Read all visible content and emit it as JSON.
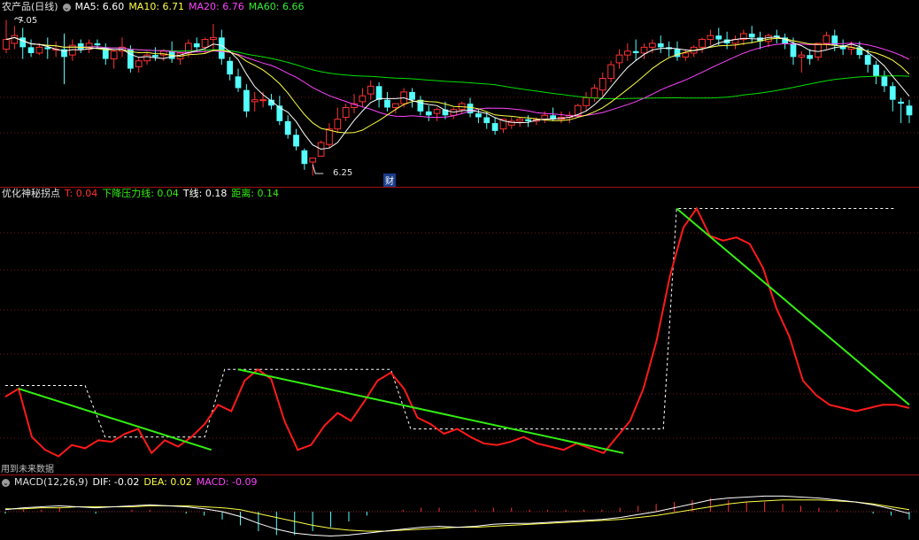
{
  "header1": {
    "name": "农产品(日线)",
    "ma5": "MA5: 6.60",
    "ma10": "MA10: 6.71",
    "ma20": "MA20: 6.76",
    "ma60": "MA60: 6.66"
  },
  "header2": {
    "name": "优化神秘拐点",
    "t": "T: 0.04",
    "down": "下降压力线: 0.04",
    "tline": "T线: 0.18",
    "dist": "距离: 0.14"
  },
  "header3": {
    "name": "MACD(12,26,9)",
    "dif": "DIF: -0.02",
    "dea": "DEA: 0.02",
    "macd": "MACD: -0.09"
  },
  "labels": {
    "high": "7.05",
    "low": "6.25",
    "cai": "财",
    "future": "用到未来数据"
  },
  "colors": {
    "up": "#ff3232",
    "down": "#54ffff",
    "ma5": "#ffffff",
    "ma10": "#ffff44",
    "ma20": "#ff44ff",
    "ma60": "#00e000",
    "t_line": "#ff1a1a",
    "pressure": "#33ee11",
    "step": "#ffffff",
    "dif": "#ffffff",
    "dea": "#ffff44"
  },
  "chart_data": [
    {
      "type": "candlestick",
      "title": "农产品(日线)",
      "candles": [
        [
          6.9,
          7.05,
          6.95,
          6.88
        ],
        [
          6.93,
          7.02,
          6.97,
          6.9
        ],
        [
          6.96,
          7.01,
          6.91,
          6.85
        ],
        [
          6.91,
          6.95,
          6.88,
          6.86
        ],
        [
          6.88,
          6.93,
          6.91,
          6.87
        ],
        [
          6.91,
          6.96,
          6.9,
          6.85
        ],
        [
          6.9,
          6.94,
          6.9,
          6.86
        ],
        [
          6.9,
          6.98,
          6.86,
          6.72
        ],
        [
          6.87,
          6.95,
          6.92,
          6.84
        ],
        [
          6.93,
          6.95,
          6.9,
          6.88
        ],
        [
          6.9,
          6.95,
          6.93,
          6.88
        ],
        [
          6.93,
          6.95,
          6.92,
          6.9
        ],
        [
          6.91,
          6.93,
          6.85,
          6.82
        ],
        [
          6.85,
          6.9,
          6.89,
          6.8
        ],
        [
          6.89,
          6.96,
          6.91,
          6.86
        ],
        [
          6.9,
          6.92,
          6.8,
          6.78
        ],
        [
          6.81,
          6.86,
          6.84,
          6.78
        ],
        [
          6.84,
          6.88,
          6.87,
          6.82
        ],
        [
          6.87,
          6.91,
          6.86,
          6.84
        ],
        [
          6.87,
          6.9,
          6.89,
          6.84
        ],
        [
          6.89,
          6.94,
          6.85,
          6.83
        ],
        [
          6.85,
          6.89,
          6.88,
          6.82
        ],
        [
          6.88,
          6.95,
          6.93,
          6.86
        ],
        [
          6.93,
          6.96,
          6.91,
          6.89
        ],
        [
          6.91,
          6.96,
          6.95,
          6.88
        ],
        [
          6.95,
          7.03,
          6.96,
          6.9
        ],
        [
          6.96,
          7.0,
          6.85,
          6.82
        ],
        [
          6.84,
          6.86,
          6.77,
          6.74
        ],
        [
          6.76,
          6.8,
          6.7,
          6.68
        ],
        [
          6.69,
          6.72,
          6.58,
          6.55
        ],
        [
          6.63,
          6.68,
          6.64,
          6.58
        ],
        [
          6.64,
          6.68,
          6.64,
          6.6
        ],
        [
          6.64,
          6.67,
          6.61,
          6.59
        ],
        [
          6.61,
          6.66,
          6.53,
          6.51
        ],
        [
          6.53,
          6.56,
          6.46,
          6.44
        ],
        [
          6.46,
          6.49,
          6.4,
          6.38
        ],
        [
          6.38,
          6.39,
          6.31,
          6.28
        ],
        [
          6.32,
          6.34,
          6.34,
          6.25
        ],
        [
          6.35,
          6.43,
          6.42,
          6.35
        ],
        [
          6.41,
          6.52,
          6.49,
          6.39
        ],
        [
          6.49,
          6.6,
          6.54,
          6.47
        ],
        [
          6.55,
          6.62,
          6.6,
          6.53
        ],
        [
          6.6,
          6.67,
          6.62,
          6.57
        ],
        [
          6.63,
          6.7,
          6.66,
          6.6
        ],
        [
          6.67,
          6.74,
          6.71,
          6.64
        ],
        [
          6.71,
          6.73,
          6.64,
          6.6
        ],
        [
          6.64,
          6.68,
          6.6,
          6.58
        ],
        [
          6.6,
          6.62,
          6.62,
          6.57
        ],
        [
          6.62,
          6.7,
          6.68,
          6.6
        ],
        [
          6.68,
          6.7,
          6.64,
          6.6
        ],
        [
          6.64,
          6.66,
          6.58,
          6.56
        ],
        [
          6.58,
          6.61,
          6.56,
          6.53
        ],
        [
          6.57,
          6.6,
          6.59,
          6.53
        ],
        [
          6.59,
          6.63,
          6.56,
          6.54
        ],
        [
          6.56,
          6.6,
          6.59,
          6.54
        ],
        [
          6.59,
          6.63,
          6.62,
          6.57
        ],
        [
          6.62,
          6.65,
          6.57,
          6.55
        ],
        [
          6.57,
          6.59,
          6.55,
          6.52
        ],
        [
          6.55,
          6.58,
          6.52,
          6.49
        ],
        [
          6.52,
          6.55,
          6.48,
          6.46
        ],
        [
          6.49,
          6.52,
          6.54,
          6.47
        ],
        [
          6.51,
          6.55,
          6.53,
          6.49
        ],
        [
          6.53,
          6.55,
          6.54,
          6.5
        ],
        [
          6.54,
          6.56,
          6.53,
          6.5
        ],
        [
          6.53,
          6.55,
          6.54,
          6.51
        ],
        [
          6.54,
          6.58,
          6.56,
          6.52
        ],
        [
          6.56,
          6.6,
          6.54,
          6.53
        ],
        [
          6.54,
          6.58,
          6.55,
          6.52
        ],
        [
          6.55,
          6.58,
          6.56,
          6.52
        ],
        [
          6.56,
          6.62,
          6.61,
          6.55
        ],
        [
          6.61,
          6.68,
          6.65,
          6.58
        ],
        [
          6.65,
          6.72,
          6.7,
          6.63
        ],
        [
          6.69,
          6.78,
          6.75,
          6.66
        ],
        [
          6.75,
          6.84,
          6.82,
          6.73
        ],
        [
          6.83,
          6.9,
          6.87,
          6.8
        ],
        [
          6.87,
          6.93,
          6.89,
          6.84
        ],
        [
          6.89,
          6.95,
          6.88,
          6.84
        ],
        [
          6.88,
          6.93,
          6.91,
          6.85
        ],
        [
          6.91,
          6.95,
          6.93,
          6.88
        ],
        [
          6.93,
          6.97,
          6.91,
          6.88
        ],
        [
          6.91,
          6.94,
          6.9,
          6.86
        ],
        [
          6.9,
          6.94,
          6.86,
          6.84
        ],
        [
          6.86,
          6.9,
          6.88,
          6.84
        ],
        [
          6.88,
          6.92,
          6.91,
          6.86
        ],
        [
          6.91,
          6.96,
          6.95,
          6.88
        ],
        [
          6.95,
          7.0,
          6.97,
          6.92
        ],
        [
          6.97,
          7.01,
          6.95,
          6.92
        ],
        [
          6.95,
          6.99,
          6.93,
          6.9
        ],
        [
          6.93,
          6.97,
          6.95,
          6.9
        ],
        [
          6.95,
          7.0,
          6.98,
          6.92
        ],
        [
          6.98,
          7.02,
          6.96,
          6.93
        ],
        [
          6.96,
          6.99,
          6.94,
          6.9
        ],
        [
          6.94,
          6.98,
          6.97,
          6.91
        ],
        [
          6.97,
          7.0,
          6.96,
          6.93
        ],
        [
          6.96,
          6.98,
          6.93,
          6.9
        ],
        [
          6.93,
          6.96,
          6.86,
          6.82
        ],
        [
          6.86,
          6.89,
          6.87,
          6.78
        ],
        [
          6.87,
          6.9,
          6.85,
          6.82
        ],
        [
          6.86,
          6.92,
          6.93,
          6.84
        ],
        [
          6.93,
          6.99,
          6.97,
          6.9
        ],
        [
          6.97,
          7.0,
          6.92,
          6.89
        ],
        [
          6.92,
          6.95,
          6.9,
          6.87
        ],
        [
          6.9,
          6.94,
          6.91,
          6.87
        ],
        [
          6.91,
          6.94,
          6.87,
          6.85
        ],
        [
          6.87,
          6.9,
          6.82,
          6.78
        ],
        [
          6.82,
          6.84,
          6.76,
          6.72
        ],
        [
          6.76,
          6.79,
          6.71,
          6.68
        ],
        [
          6.71,
          6.73,
          6.64,
          6.58
        ],
        [
          6.63,
          6.65,
          6.62,
          6.52
        ],
        [
          6.61,
          6.64,
          6.56,
          6.52
        ]
      ]
    },
    {
      "type": "line",
      "title": "优化神秘拐点",
      "series": [
        {
          "name": "T",
          "values": [
            0.45,
            0.5,
            0.2,
            0.12,
            0.08,
            0.15,
            0.13,
            0.18,
            0.17,
            0.22,
            0.25,
            0.1,
            0.18,
            0.14,
            0.2,
            0.28,
            0.4,
            0.36,
            0.55,
            0.62,
            0.56,
            0.3,
            0.12,
            0.15,
            0.27,
            0.35,
            0.3,
            0.42,
            0.55,
            0.6,
            0.5,
            0.32,
            0.28,
            0.22,
            0.25,
            0.2,
            0.16,
            0.15,
            0.17,
            0.2,
            0.16,
            0.14,
            0.12,
            0.16,
            0.13,
            0.1,
            0.2,
            0.3,
            0.5,
            0.8,
            1.2,
            1.5,
            1.62,
            1.45,
            1.42,
            1.44,
            1.4,
            1.25,
            1.0,
            0.82,
            0.55,
            0.46,
            0.4,
            0.38,
            0.36,
            0.38,
            0.4,
            0.4,
            0.38
          ]
        },
        {
          "name": "下降压力线",
          "values": [
            0.04
          ]
        },
        {
          "name": "T线",
          "values": [
            0.18
          ]
        },
        {
          "name": "距离",
          "values": [
            0.14
          ]
        }
      ]
    },
    {
      "type": "bar",
      "title": "MACD(12,26,9)",
      "series": [
        {
          "name": "DIF",
          "values": [
            0.02,
            0.04,
            0.05,
            0.06,
            0.05,
            0.04,
            0.05,
            0.06,
            0.07,
            0.06,
            0.05,
            0.03,
            0.0,
            -0.05,
            -0.12,
            -0.18,
            -0.22,
            -0.24,
            -0.25,
            -0.24,
            -0.22,
            -0.2,
            -0.18,
            -0.16,
            -0.15,
            -0.16,
            -0.15,
            -0.13,
            -0.12,
            -0.12,
            -0.11,
            -0.1,
            -0.09,
            -0.08,
            -0.06,
            -0.03,
            0.0,
            0.04,
            0.08,
            0.12,
            0.14,
            0.15,
            0.16,
            0.16,
            0.15,
            0.14,
            0.12,
            0.1,
            0.07,
            0.03,
            -0.02
          ]
        },
        {
          "name": "DEA",
          "values": [
            0.03,
            0.03,
            0.04,
            0.04,
            0.05,
            0.05,
            0.05,
            0.05,
            0.06,
            0.06,
            0.06,
            0.05,
            0.04,
            0.02,
            -0.02,
            -0.06,
            -0.1,
            -0.14,
            -0.17,
            -0.19,
            -0.2,
            -0.2,
            -0.19,
            -0.18,
            -0.17,
            -0.16,
            -0.16,
            -0.15,
            -0.14,
            -0.13,
            -0.12,
            -0.11,
            -0.1,
            -0.09,
            -0.08,
            -0.06,
            -0.04,
            -0.01,
            0.02,
            0.05,
            0.08,
            0.1,
            0.11,
            0.12,
            0.12,
            0.12,
            0.11,
            0.1,
            0.08,
            0.05,
            0.02
          ]
        },
        {
          "name": "MACD",
          "values": [
            -0.09
          ]
        }
      ]
    }
  ]
}
